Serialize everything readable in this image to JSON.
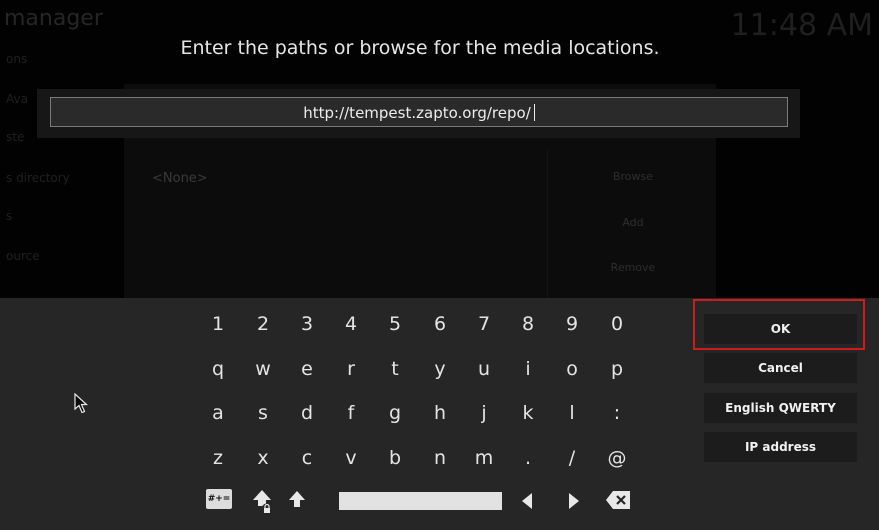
{
  "background": {
    "title_fragment": "manager",
    "clock_fragment": "11:48 AM",
    "side_items": [
      "ons",
      "Ava",
      "ste",
      "s directory",
      "s",
      "ource"
    ],
    "source_value": "<None>",
    "buttons": [
      "Browse",
      "Add",
      "Remove"
    ]
  },
  "dialog": {
    "heading": "Enter the paths or browse for the media locations.",
    "input_value": "http://tempest.zapto.org/repo/"
  },
  "keyboard": {
    "rows": [
      [
        "1",
        "2",
        "3",
        "4",
        "5",
        "6",
        "7",
        "8",
        "9",
        "0"
      ],
      [
        "q",
        "w",
        "e",
        "r",
        "t",
        "y",
        "u",
        "i",
        "o",
        "p"
      ],
      [
        "a",
        "s",
        "d",
        "f",
        "g",
        "h",
        "j",
        "k",
        "l",
        ":"
      ],
      [
        "z",
        "x",
        "c",
        "v",
        "b",
        "n",
        "m",
        ".",
        "/",
        "@"
      ]
    ],
    "symbol_key": "#+=",
    "icons": {
      "caps_lock": "caps-lock-icon",
      "shift": "shift-icon",
      "left": "arrow-left-icon",
      "right": "arrow-right-icon",
      "backspace": "backspace-icon"
    }
  },
  "actions": {
    "ok": "OK",
    "cancel": "Cancel",
    "layout": "English QWERTY",
    "ip": "IP address"
  },
  "colors": {
    "highlight": "#d11b1b",
    "keyboard_bg": "#262626",
    "button_bg": "#1c1c1c"
  }
}
